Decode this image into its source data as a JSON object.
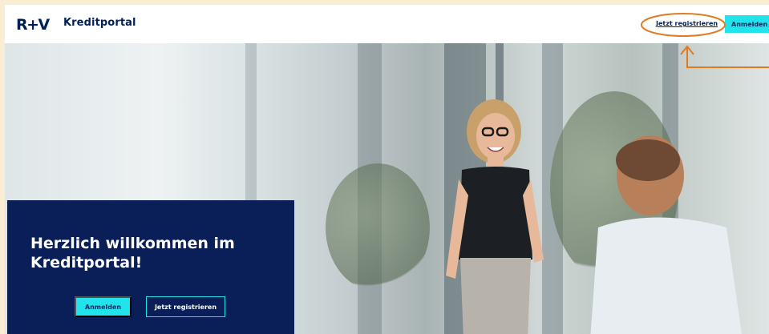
{
  "header": {
    "logo_text": "R+V",
    "app_name": "Kreditportal",
    "register_link": "Jetzt registrieren",
    "login_button": "Anmelden"
  },
  "hero": {
    "welcome_title": "Herzlich willkommen im Kreditportal!",
    "login_button": "Anmelden",
    "register_button": "Jetzt registrieren"
  },
  "colors": {
    "brand_navy": "#0a1f57",
    "accent_cyan": "#21e3ec",
    "annotation_orange": "#e07b22",
    "outer_background": "#fbecd4"
  }
}
